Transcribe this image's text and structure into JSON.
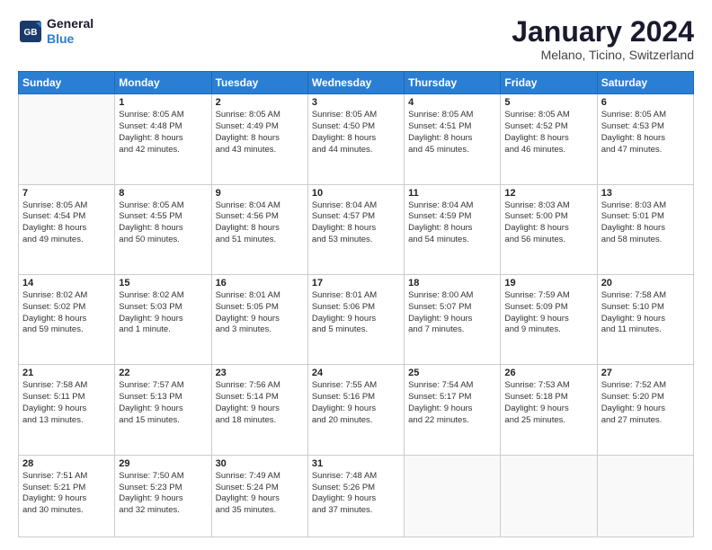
{
  "logo": {
    "line1": "General",
    "line2": "Blue"
  },
  "title": "January 2024",
  "subtitle": "Melano, Ticino, Switzerland",
  "weekdays": [
    "Sunday",
    "Monday",
    "Tuesday",
    "Wednesday",
    "Thursday",
    "Friday",
    "Saturday"
  ],
  "weeks": [
    [
      {
        "day": "",
        "info": ""
      },
      {
        "day": "1",
        "info": "Sunrise: 8:05 AM\nSunset: 4:48 PM\nDaylight: 8 hours\nand 42 minutes."
      },
      {
        "day": "2",
        "info": "Sunrise: 8:05 AM\nSunset: 4:49 PM\nDaylight: 8 hours\nand 43 minutes."
      },
      {
        "day": "3",
        "info": "Sunrise: 8:05 AM\nSunset: 4:50 PM\nDaylight: 8 hours\nand 44 minutes."
      },
      {
        "day": "4",
        "info": "Sunrise: 8:05 AM\nSunset: 4:51 PM\nDaylight: 8 hours\nand 45 minutes."
      },
      {
        "day": "5",
        "info": "Sunrise: 8:05 AM\nSunset: 4:52 PM\nDaylight: 8 hours\nand 46 minutes."
      },
      {
        "day": "6",
        "info": "Sunrise: 8:05 AM\nSunset: 4:53 PM\nDaylight: 8 hours\nand 47 minutes."
      }
    ],
    [
      {
        "day": "7",
        "info": "Sunrise: 8:05 AM\nSunset: 4:54 PM\nDaylight: 8 hours\nand 49 minutes."
      },
      {
        "day": "8",
        "info": "Sunrise: 8:05 AM\nSunset: 4:55 PM\nDaylight: 8 hours\nand 50 minutes."
      },
      {
        "day": "9",
        "info": "Sunrise: 8:04 AM\nSunset: 4:56 PM\nDaylight: 8 hours\nand 51 minutes."
      },
      {
        "day": "10",
        "info": "Sunrise: 8:04 AM\nSunset: 4:57 PM\nDaylight: 8 hours\nand 53 minutes."
      },
      {
        "day": "11",
        "info": "Sunrise: 8:04 AM\nSunset: 4:59 PM\nDaylight: 8 hours\nand 54 minutes."
      },
      {
        "day": "12",
        "info": "Sunrise: 8:03 AM\nSunset: 5:00 PM\nDaylight: 8 hours\nand 56 minutes."
      },
      {
        "day": "13",
        "info": "Sunrise: 8:03 AM\nSunset: 5:01 PM\nDaylight: 8 hours\nand 58 minutes."
      }
    ],
    [
      {
        "day": "14",
        "info": "Sunrise: 8:02 AM\nSunset: 5:02 PM\nDaylight: 8 hours\nand 59 minutes."
      },
      {
        "day": "15",
        "info": "Sunrise: 8:02 AM\nSunset: 5:03 PM\nDaylight: 9 hours\nand 1 minute."
      },
      {
        "day": "16",
        "info": "Sunrise: 8:01 AM\nSunset: 5:05 PM\nDaylight: 9 hours\nand 3 minutes."
      },
      {
        "day": "17",
        "info": "Sunrise: 8:01 AM\nSunset: 5:06 PM\nDaylight: 9 hours\nand 5 minutes."
      },
      {
        "day": "18",
        "info": "Sunrise: 8:00 AM\nSunset: 5:07 PM\nDaylight: 9 hours\nand 7 minutes."
      },
      {
        "day": "19",
        "info": "Sunrise: 7:59 AM\nSunset: 5:09 PM\nDaylight: 9 hours\nand 9 minutes."
      },
      {
        "day": "20",
        "info": "Sunrise: 7:58 AM\nSunset: 5:10 PM\nDaylight: 9 hours\nand 11 minutes."
      }
    ],
    [
      {
        "day": "21",
        "info": "Sunrise: 7:58 AM\nSunset: 5:11 PM\nDaylight: 9 hours\nand 13 minutes."
      },
      {
        "day": "22",
        "info": "Sunrise: 7:57 AM\nSunset: 5:13 PM\nDaylight: 9 hours\nand 15 minutes."
      },
      {
        "day": "23",
        "info": "Sunrise: 7:56 AM\nSunset: 5:14 PM\nDaylight: 9 hours\nand 18 minutes."
      },
      {
        "day": "24",
        "info": "Sunrise: 7:55 AM\nSunset: 5:16 PM\nDaylight: 9 hours\nand 20 minutes."
      },
      {
        "day": "25",
        "info": "Sunrise: 7:54 AM\nSunset: 5:17 PM\nDaylight: 9 hours\nand 22 minutes."
      },
      {
        "day": "26",
        "info": "Sunrise: 7:53 AM\nSunset: 5:18 PM\nDaylight: 9 hours\nand 25 minutes."
      },
      {
        "day": "27",
        "info": "Sunrise: 7:52 AM\nSunset: 5:20 PM\nDaylight: 9 hours\nand 27 minutes."
      }
    ],
    [
      {
        "day": "28",
        "info": "Sunrise: 7:51 AM\nSunset: 5:21 PM\nDaylight: 9 hours\nand 30 minutes."
      },
      {
        "day": "29",
        "info": "Sunrise: 7:50 AM\nSunset: 5:23 PM\nDaylight: 9 hours\nand 32 minutes."
      },
      {
        "day": "30",
        "info": "Sunrise: 7:49 AM\nSunset: 5:24 PM\nDaylight: 9 hours\nand 35 minutes."
      },
      {
        "day": "31",
        "info": "Sunrise: 7:48 AM\nSunset: 5:26 PM\nDaylight: 9 hours\nand 37 minutes."
      },
      {
        "day": "",
        "info": ""
      },
      {
        "day": "",
        "info": ""
      },
      {
        "day": "",
        "info": ""
      }
    ]
  ]
}
